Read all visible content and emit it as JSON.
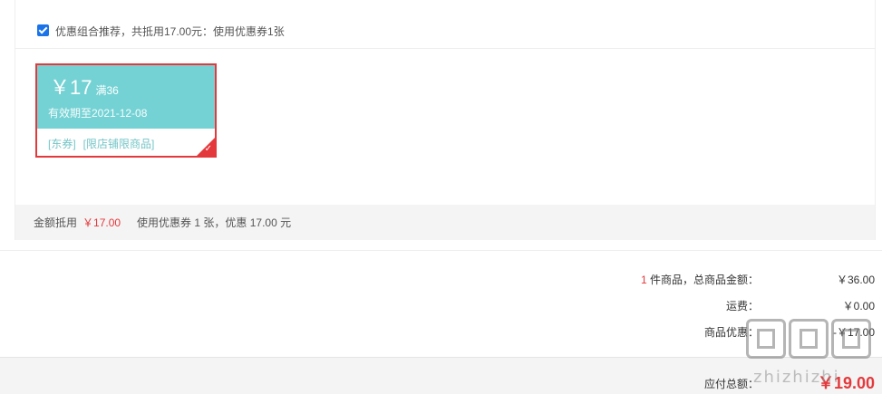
{
  "combo": {
    "checked": true,
    "label": "优惠组合推荐，共抵用17.00元：使用优惠券1张"
  },
  "coupon": {
    "amount": "￥17",
    "threshold": "满36",
    "expiry": "有效期至2021-12-08",
    "tags": [
      "[东券]",
      "[限店铺限商品]"
    ],
    "selected": true
  },
  "summary": {
    "label": "金额抵用",
    "amount": "￥17.00",
    "detail": "使用优惠券 1 张，优惠 17.00 元"
  },
  "totals": {
    "count": "1",
    "goods_label": " 件商品，总商品金额：",
    "goods_value": "￥36.00",
    "shipping_label": "运费：",
    "shipping_value": "￥0.00",
    "discount_label": "商品优惠：",
    "discount_value": "-￥17.00"
  },
  "payable": {
    "label": "应付总额：",
    "value": "￥19.00"
  },
  "watermark": {
    "text": "zhizhizhi"
  },
  "colors": {
    "accent_red": "#e4393c",
    "coupon_teal": "#74d2d4",
    "checkbox_blue": "#1a73e8"
  }
}
